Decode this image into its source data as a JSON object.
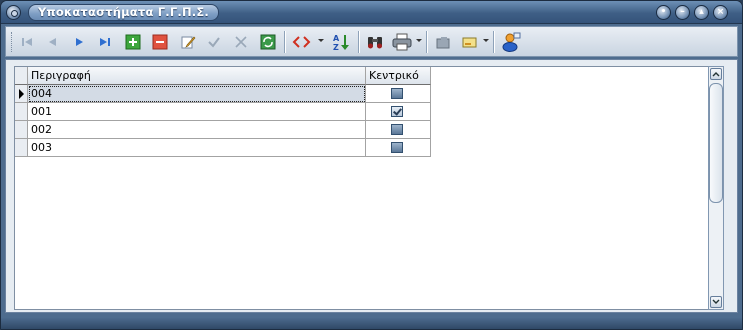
{
  "window": {
    "title": "Υποκαταστήματα Γ.Γ.Π.Σ."
  },
  "toolbar": {
    "buttons": [
      {
        "name": "first-record",
        "icon": "first-record-icon"
      },
      {
        "name": "previous-record",
        "icon": "prev-record-icon"
      },
      {
        "name": "next-record",
        "icon": "next-record-icon"
      },
      {
        "name": "last-record",
        "icon": "last-record-icon"
      },
      {
        "name": "add-record",
        "icon": "plus-icon"
      },
      {
        "name": "delete-record",
        "icon": "minus-icon"
      },
      {
        "name": "edit-record",
        "icon": "pencil-icon"
      },
      {
        "name": "post-record",
        "icon": "checkmark-icon"
      },
      {
        "name": "cancel-edit",
        "icon": "cross-icon"
      },
      {
        "name": "refresh",
        "icon": "refresh-icon"
      },
      {
        "name": "filter",
        "icon": "code-brackets-icon"
      },
      {
        "name": "sort",
        "icon": "sort-az-icon"
      },
      {
        "name": "find",
        "icon": "binoculars-icon"
      },
      {
        "name": "print",
        "icon": "printer-icon"
      },
      {
        "name": "export",
        "icon": "folder-icon"
      },
      {
        "name": "layout",
        "icon": "window-icon"
      },
      {
        "name": "user",
        "icon": "user-icon"
      }
    ]
  },
  "grid": {
    "columns": [
      "Περιγραφή",
      "Κεντρικό"
    ],
    "rows": [
      {
        "description": "004",
        "central": false
      },
      {
        "description": "001",
        "central": true
      },
      {
        "description": "002",
        "central": false
      },
      {
        "description": "003",
        "central": false
      }
    ],
    "current_row": 0
  },
  "colors": {
    "titlebar": "#3f5f86",
    "toolbar": "#d9e1ea",
    "selection": "#d3dbe5"
  }
}
